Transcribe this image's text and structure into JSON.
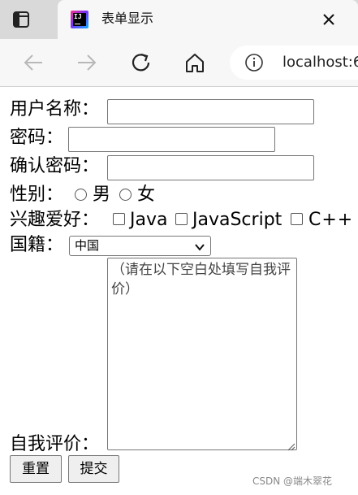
{
  "browser": {
    "tab_title": "表单显示",
    "address": "localhost:6"
  },
  "form": {
    "username_label": "用户名称：",
    "password_label": "密码：",
    "confirm_label": "确认密码：",
    "gender_label": "性别：",
    "gender_options": [
      "男",
      "女"
    ],
    "hobby_label": "兴趣爱好：",
    "hobby_options": [
      "Java",
      "JavaScript",
      "C++"
    ],
    "nationality_label": "国籍：",
    "nationality_selected": "中国",
    "intro_label": "自我评价：",
    "intro_value": "（请在以下空白处填写自我评价）",
    "reset_label": "重置",
    "submit_label": "提交"
  },
  "watermark": "CSDN @端木翠花"
}
